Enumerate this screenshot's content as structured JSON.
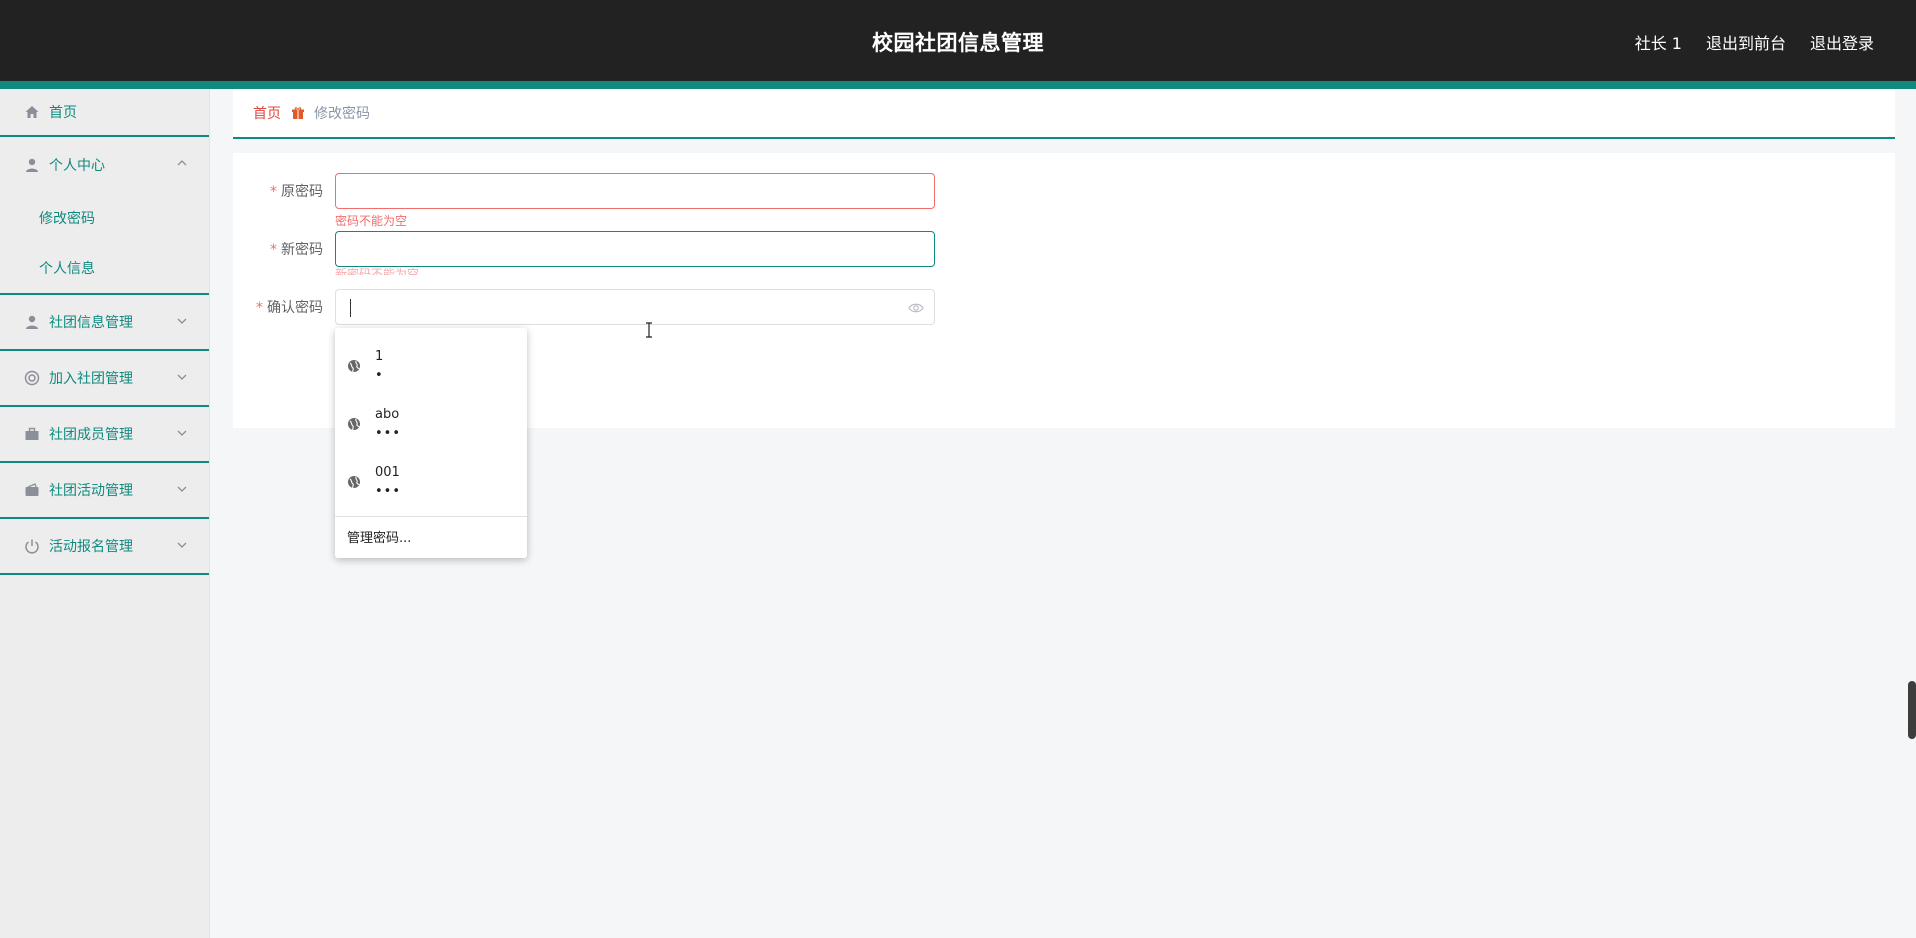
{
  "header": {
    "title": "校园社团信息管理",
    "user": "社长 1",
    "front_link": "退出到前台",
    "logout": "退出登录"
  },
  "sidebar": {
    "home": "首页",
    "personal_center": "个人中心",
    "change_password": "修改密码",
    "personal_info": "个人信息",
    "club_info": "社团信息管理",
    "join_club": "加入社团管理",
    "club_members": "社团成员管理",
    "club_activities": "社团活动管理",
    "activity_signup": "活动报名管理"
  },
  "breadcrumb": {
    "home": "首页",
    "current": "修改密码"
  },
  "form": {
    "required_mark": "*",
    "old_password_label": "原密码",
    "old_password_error": "密码不能为空",
    "new_password_label": "新密码",
    "new_password_error": "新密码不能为空",
    "confirm_password_label": "确认密码"
  },
  "autofill": {
    "entries": [
      {
        "user": "1",
        "password": "•"
      },
      {
        "user": "abo",
        "password": "•••"
      },
      {
        "user": "001",
        "password": "•••"
      }
    ],
    "manage": "管理密码..."
  },
  "colors": {
    "accent": "#0f8a80",
    "header_bg": "#222222",
    "error": "#f56c6c"
  }
}
